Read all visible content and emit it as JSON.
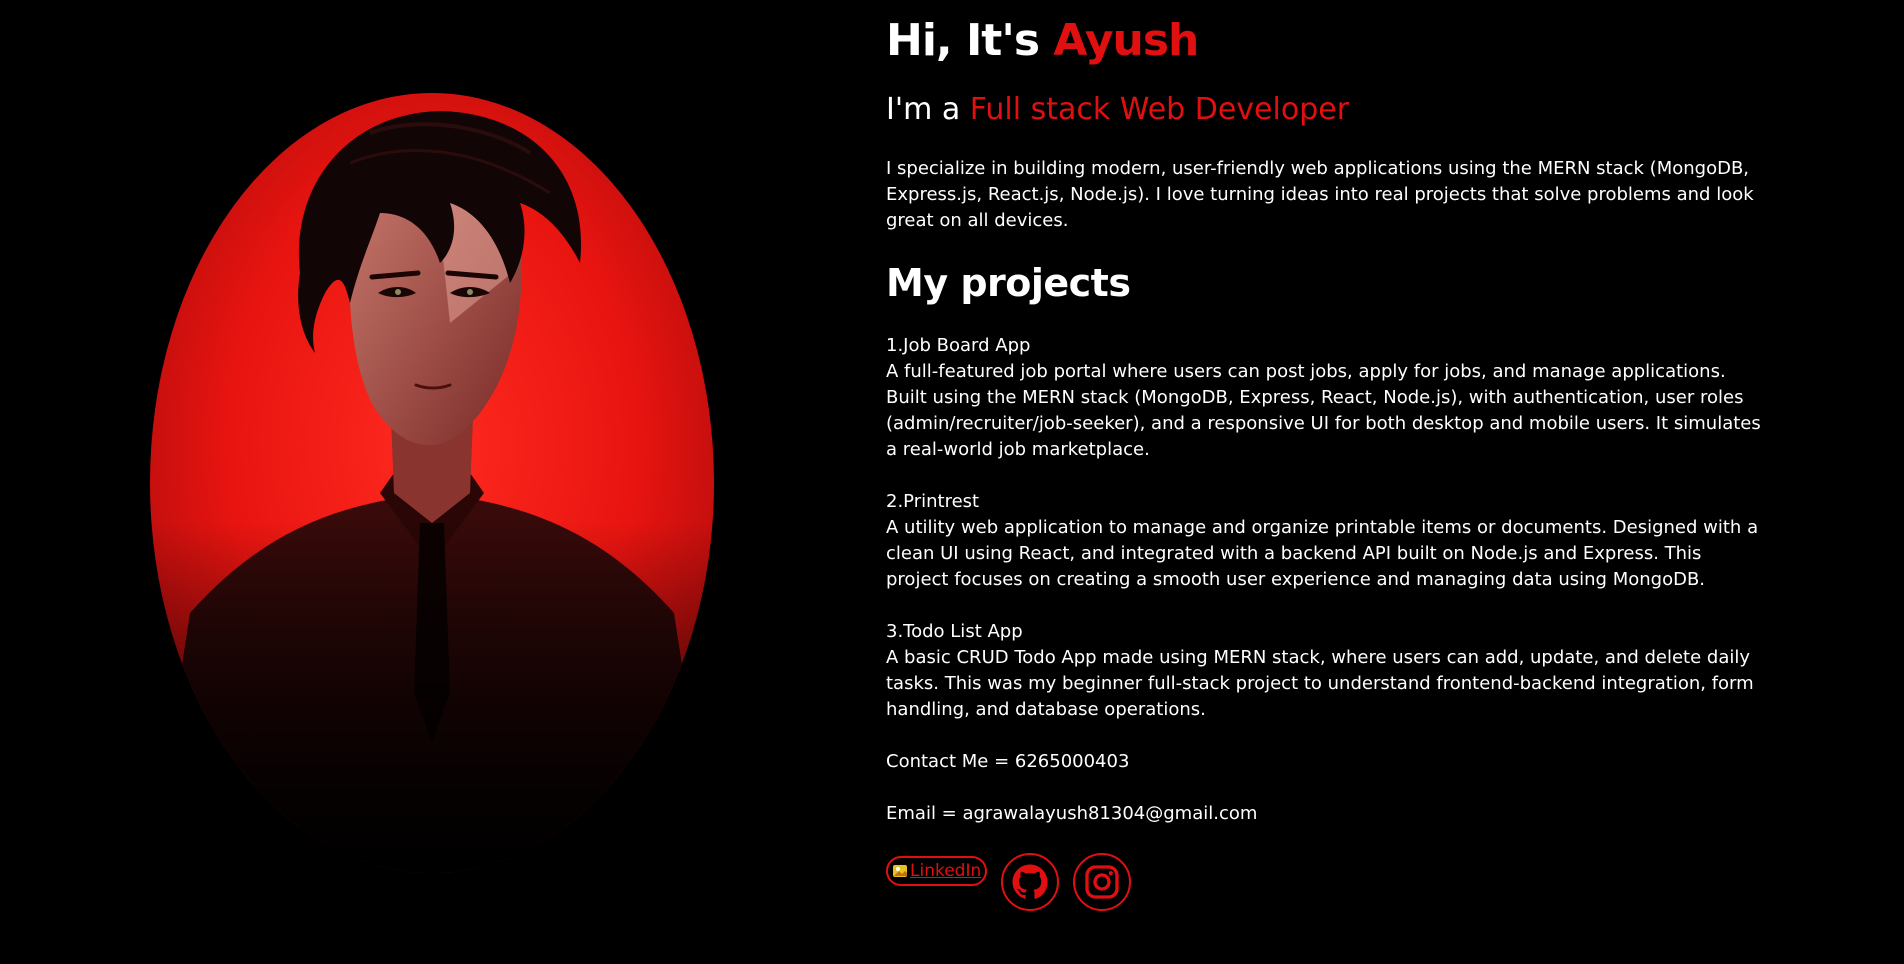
{
  "colors": {
    "background": "#000000",
    "accent": "#e01010",
    "text": "#ffffff"
  },
  "hero": {
    "greeting": "Hi, It's ",
    "name": "Ayush",
    "role_prefix": "I'm a ",
    "role": "Full stack Web Developer",
    "intro": "I specialize in building modern, user-friendly web applications using the MERN stack (MongoDB, Express.js, React.js, Node.js). I love turning ideas into real projects that solve problems and look great on all devices."
  },
  "projects": {
    "heading": "My projects",
    "items": [
      {
        "title": "1.Job Board App",
        "description": "A full-featured job portal where users can post jobs, apply for jobs, and manage applications. Built using the MERN stack (MongoDB, Express, React, Node.js), with authentication, user roles (admin/recruiter/job-seeker), and a responsive UI for both desktop and mobile users. It simulates a real-world job marketplace."
      },
      {
        "title": "2.Printrest",
        "description": "A utility web application to manage and organize printable items or documents. Designed with a clean UI using React, and integrated with a backend API built on Node.js and Express. This project focuses on creating a smooth user experience and managing data using MongoDB."
      },
      {
        "title": "3.Todo List App",
        "description": "A basic CRUD Todo App made using MERN stack, where users can add, update, and delete daily tasks. This was my beginner full-stack project to understand frontend-backend integration, form handling, and database operations."
      }
    ]
  },
  "contact": {
    "phone": "Contact Me = 6265000403",
    "email": "Email = agrawalayush81304@gmail.com"
  },
  "socials": {
    "linkedin_label": "LinkedIn",
    "github_icon": "github-icon",
    "instagram_icon": "instagram-icon"
  }
}
